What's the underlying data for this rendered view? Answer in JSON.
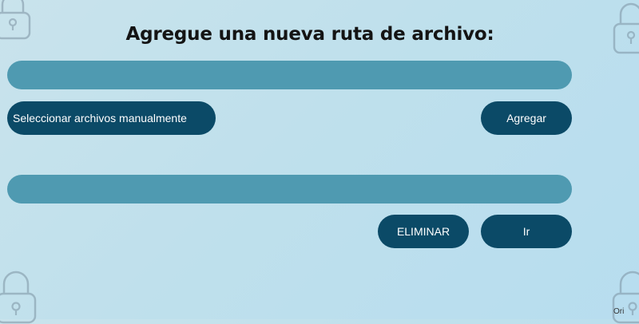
{
  "page": {
    "title": "Agregue una nueva ruta de archivo:",
    "watermark": "Ori"
  },
  "inputs": {
    "path_1": {
      "value": "",
      "placeholder": ""
    },
    "path_2": {
      "value": "",
      "placeholder": ""
    }
  },
  "buttons": {
    "select_files": "Seleccionar archivos manualmente",
    "add": "Agregar",
    "delete": "ELIMINAR",
    "go": "Ir"
  },
  "icons": {
    "decorative": [
      "padlock-icon",
      "padlock-icon",
      "padlock-icon",
      "padlock-icon"
    ]
  },
  "colors": {
    "background": "#bfe0ec",
    "input_bar": "#4f9ab1",
    "button": "#0b4a67",
    "button_text": "#ffffff",
    "title_text": "#141414"
  }
}
